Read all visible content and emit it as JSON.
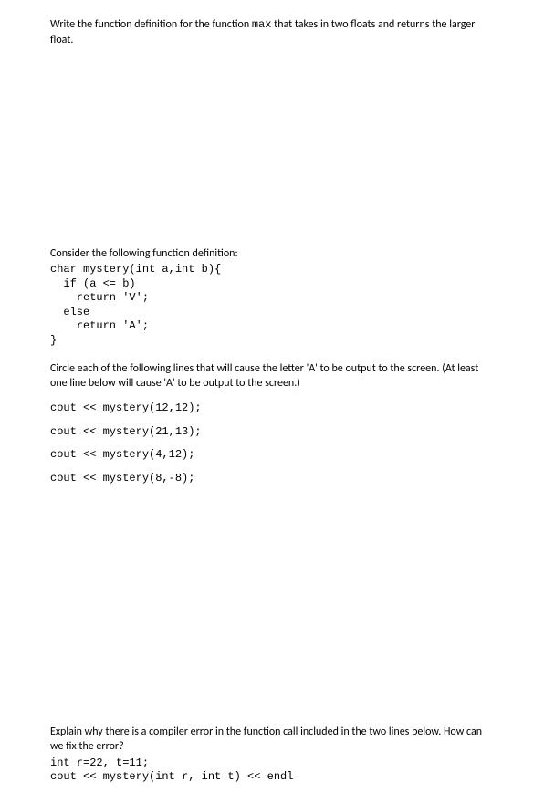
{
  "q1": {
    "text_a": "Write the function definition for the function ",
    "code_inline": "max",
    "text_b": " that takes in two floats and returns the larger float."
  },
  "q2": {
    "intro": "Consider the following function definition:",
    "code": "char mystery(int a,int b){\n  if (a <= b)\n    return 'V';\n  else\n    return 'A';\n}",
    "instruction": "Circle each of the following lines that will cause the letter 'A' to be output to the screen. (At least one line below will cause 'A' to be output to the screen.)",
    "lines": [
      "cout << mystery(12,12);",
      "cout << mystery(21,13);",
      "cout << mystery(4,12);",
      "cout << mystery(8,-8);"
    ]
  },
  "q3": {
    "text": "Explain why there is a compiler error in the function call included in the two lines below. How can we fix the error?",
    "code": "int r=22, t=11;\ncout << mystery(int r, int t) << endl"
  }
}
